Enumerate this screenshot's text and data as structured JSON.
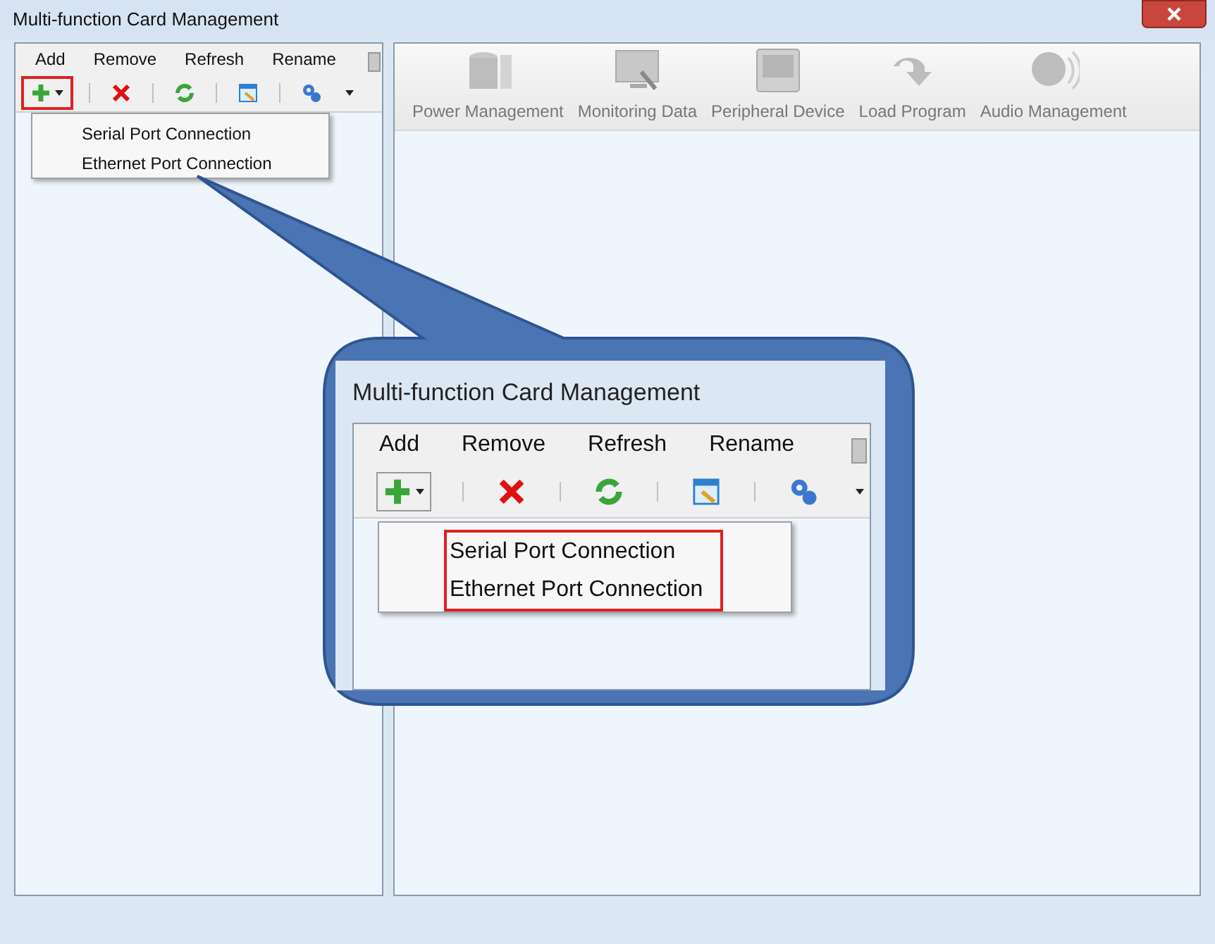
{
  "window": {
    "title": "Multi-function Card Management"
  },
  "card_panel": {
    "menu": [
      "Add",
      "Remove",
      "Refresh",
      "Rename"
    ],
    "toolbar": [
      {
        "kind": "add",
        "highlighted": true
      },
      {
        "kind": "remove",
        "highlighted": false
      },
      {
        "kind": "refresh",
        "highlighted": false
      },
      {
        "kind": "rename",
        "highlighted": false
      },
      {
        "kind": "settings",
        "highlighted": false
      }
    ],
    "dropdown": [
      "Serial Port Connection",
      "Ethernet Port Connection"
    ]
  },
  "modules": [
    {
      "kind": "power",
      "label": "Power Management"
    },
    {
      "kind": "monitor",
      "label": "Monitoring Data"
    },
    {
      "kind": "peripheral",
      "label": "Peripheral Device"
    },
    {
      "kind": "load",
      "label": "Load Program"
    },
    {
      "kind": "audio",
      "label": "Audio Management"
    }
  ],
  "callout": {
    "title": "Multi-function Card Management",
    "menu": [
      "Add",
      "Remove",
      "Refresh",
      "Rename"
    ],
    "dropdown": [
      "Serial Port Connection",
      "Ethernet Port Connection"
    ],
    "dropdown_highlighted": true
  }
}
